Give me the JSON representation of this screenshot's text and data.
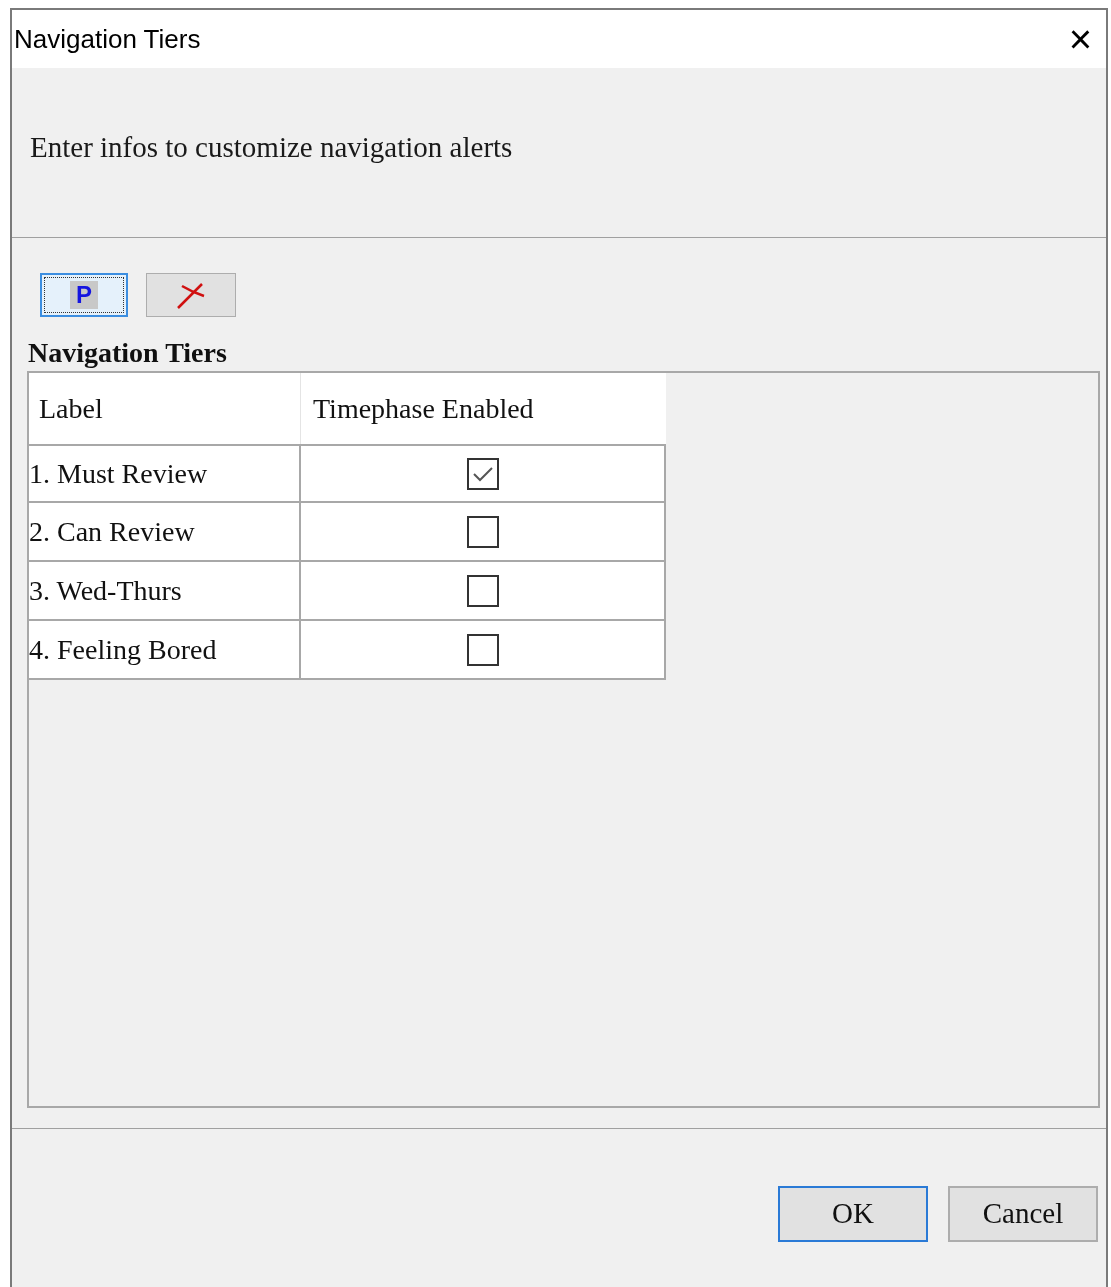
{
  "window": {
    "title": "Navigation Tiers",
    "close": "×"
  },
  "header": {
    "message": "Enter infos to customize navigation alerts"
  },
  "toolbar": [
    {
      "kind": "letter",
      "label": "P",
      "focused": true
    },
    {
      "kind": "delete",
      "focused": false
    }
  ],
  "section_title": "Navigation Tiers",
  "table": {
    "columns": [
      "Label",
      "Timephase Enabled"
    ],
    "rows": [
      {
        "label": "1. Must Review",
        "checked": true
      },
      {
        "label": "2. Can Review",
        "checked": false
      },
      {
        "label": "3. Wed-Thurs",
        "checked": false
      },
      {
        "label": "4. Feeling Bored",
        "checked": false
      }
    ]
  },
  "buttons": [
    {
      "label": "OK",
      "default": true
    },
    {
      "label": "Cancel",
      "default": false
    }
  ]
}
